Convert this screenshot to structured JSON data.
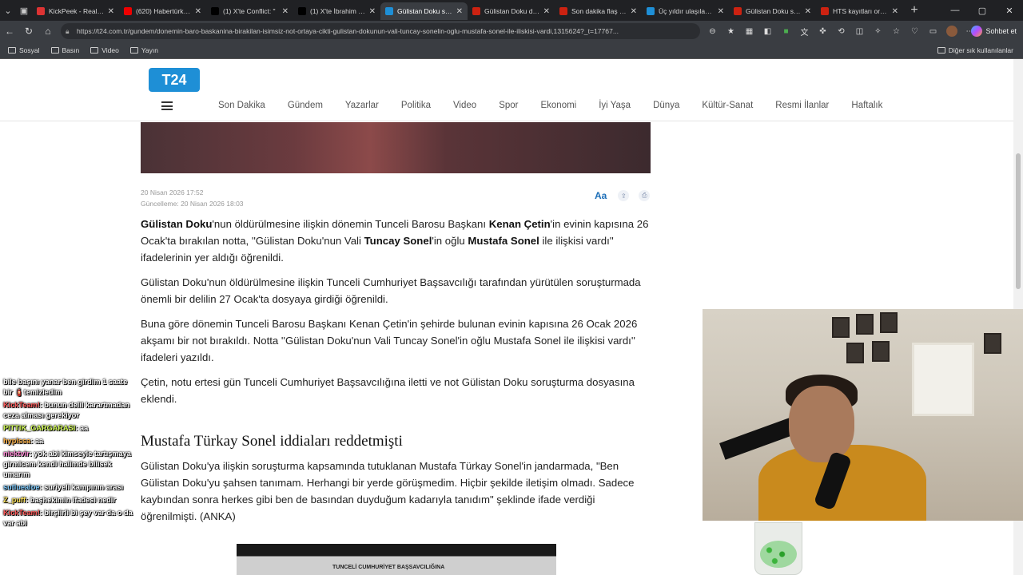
{
  "tabs": [
    {
      "title": "KickPeek - Real-tim",
      "color": "#d33"
    },
    {
      "title": "(620) Habertürk TV",
      "color": "#e00"
    },
    {
      "title": "(1) X'te Conflict: \"",
      "color": "#000"
    },
    {
      "title": "(1) X'te İbrahim Ha",
      "color": "#000"
    },
    {
      "title": "Gülistan Doku soru",
      "color": "#1e8fd6",
      "active": true
    },
    {
      "title": "Gülistan Doku dosy",
      "color": "#c21"
    },
    {
      "title": "Son dakika flaş geliş",
      "color": "#c21"
    },
    {
      "title": "Üç yıldır ulaşılamay",
      "color": "#1e8fd6"
    },
    {
      "title": "Gülistan Doku soru",
      "color": "#c21"
    },
    {
      "title": "HTS kayıtları ortaya",
      "color": "#c21"
    }
  ],
  "address": {
    "url": "https://t24.com.tr/gundem/donemin-baro-baskanina-birakilan-isimsiz-not-ortaya-cikti-gulistan-dokunun-vali-tuncay-sonelin-oglu-mustafa-sonel-ile-iliskisi-vardi,1315624?_t=17767..."
  },
  "toolbar": {
    "chat_label": "Sohbet et"
  },
  "bookmarks": {
    "items": [
      "Sosyal",
      "Basın",
      "Video",
      "Yayın"
    ],
    "other": "Diğer sık kullanılanlar"
  },
  "site": {
    "logo": "T24",
    "nav": [
      "Son Dakika",
      "Gündem",
      "Yazarlar",
      "Politika",
      "Video",
      "Spor",
      "Ekonomi",
      "İyi Yaşa",
      "Dünya",
      "Kültür-Sanat",
      "Resmi İlanlar",
      "Haftalık"
    ]
  },
  "article": {
    "date": "20 Nisan 2026 17:52",
    "updated": "Güncelleme: 20 Nisan 2026 18:03",
    "font_label": "Aa",
    "p1": {
      "a": "Gülistan Doku",
      "b": "'nun öldürülmesine ilişkin dönemin Tunceli Barosu Başkanı ",
      "c": "Kenan Çetin",
      "d": "'in evinin kapısına 26 Ocak'ta bırakılan notta, ''Gülistan Doku'nun Vali ",
      "e": "Tuncay Sonel",
      "f": "'in oğlu ",
      "g": "Mustafa Sonel",
      "h": " ile ilişkisi vardı'' ifadelerinin yer aldığı öğrenildi."
    },
    "p2": "Gülistan Doku'nun öldürülmesine ilişkin Tunceli Cumhuriyet Başsavcılığı tarafından yürütülen soruşturmada önemli bir delilin 27 Ocak'ta dosyaya girdiği öğrenildi.",
    "p3": "Buna göre dönemin Tunceli Barosu Başkanı Kenan Çetin'in şehirde bulunan evinin kapısına 26 Ocak 2026 akşamı bir not bırakıldı. Notta ''Gülistan Doku'nun Vali Tuncay Sonel'in oğlu Mustafa Sonel ile ilişkisi vardı'' ifadeleri yazıldı.",
    "p4": "Çetin, notu ertesi gün Tunceli Cumhuriyet Başsavcılığına iletti ve not Gülistan Doku soruşturma dosyasına eklendi.",
    "h2": "Mustafa Türkay Sonel iddiaları reddetmişti",
    "p5": "Gülistan Doku'ya ilişkin soruşturma kapsamında tutuklanan Mustafa Türkay Sonel'in jandarmada, \"Ben Gülistan Doku'yu şahsen tanımam. Herhangi bir yerde görüşmedim. Hiçbir şekilde iletişim olmadı. Sadece kaybından sonra herkes gibi ben de basından duyduğum kadarıyla tanıdım\" şeklinde ifade verdiği öğrenilmişti. (ANKA)",
    "doc_caption": "TUNCELİ CUMHURİYET BAŞSAVCILIĞINA"
  },
  "chat": [
    {
      "user": "",
      "color": "#fff",
      "text": "bile başını yanar ben girdim 1 saate bir 🧯temizledim"
    },
    {
      "user": "KickTeam!",
      "color": "#ff5a5a",
      "text": "bunun delil karartmadan ceza alması gerekiyor"
    },
    {
      "user": "PITTIK_GARGARASI",
      "color": "#d6ff5a",
      "text": "aa"
    },
    {
      "user": "hyplssa",
      "color": "#ffb347",
      "text": "aa"
    },
    {
      "user": "niektvir",
      "color": "#ff8ad6",
      "text": "yok abi kimseyle tartışmaya girmicem kendi halimde bilisek umarım"
    },
    {
      "user": "sutluealoe",
      "color": "#7ecbff",
      "text": "suriyeli kampının arası"
    },
    {
      "user": "Z_puff",
      "color": "#ffe45a",
      "text": "başhekimin ifadesi nedir"
    },
    {
      "user": "KickTeam!",
      "color": "#ff5a5a",
      "text": "birşiirli bi şey var da o da var abi"
    }
  ]
}
